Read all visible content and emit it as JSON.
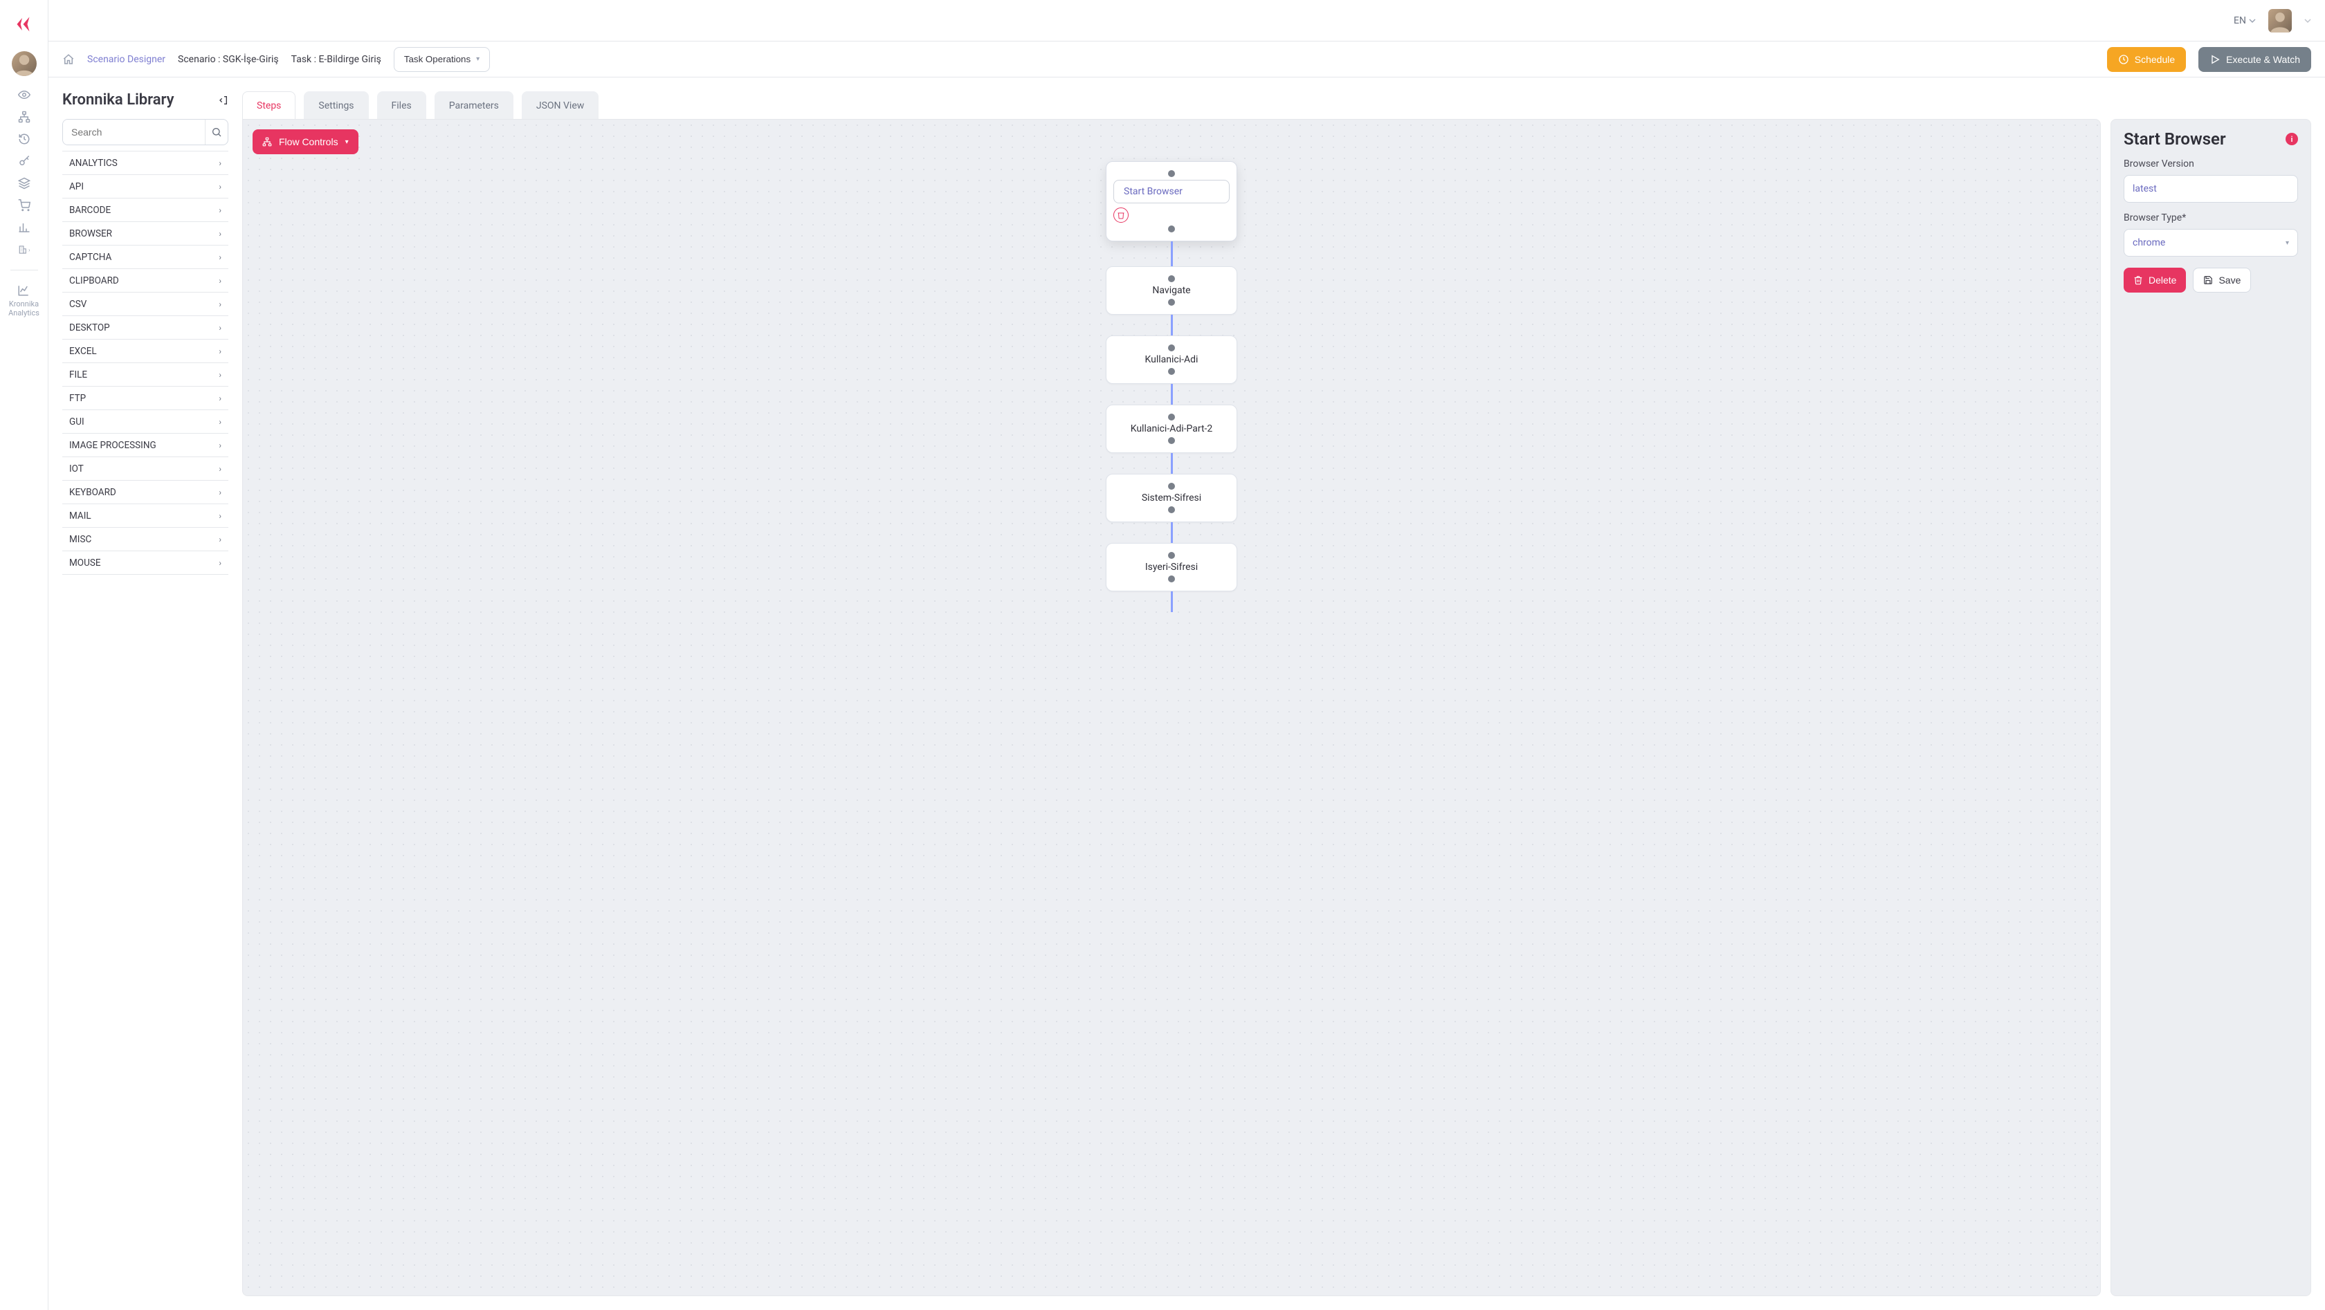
{
  "language": "EN",
  "breadcrumb": {
    "designer": "Scenario Designer",
    "scenario": "Scenario : SGK-İşe-Giriş",
    "task": "Task : E-Bildirge Giriş"
  },
  "taskOpsLabel": "Task Operations",
  "buttons": {
    "schedule": "Schedule",
    "execute": "Execute & Watch"
  },
  "library": {
    "title": "Kronnika Library",
    "searchPlaceholder": "Search",
    "categories": [
      "ANALYTICS",
      "API",
      "BARCODE",
      "BROWSER",
      "CAPTCHA",
      "CLIPBOARD",
      "CSV",
      "DESKTOP",
      "EXCEL",
      "FILE",
      "FTP",
      "GUI",
      "IMAGE PROCESSING",
      "IOT",
      "KEYBOARD",
      "MAIL",
      "MISC",
      "MOUSE"
    ]
  },
  "tabs": [
    "Steps",
    "Settings",
    "Files",
    "Parameters",
    "JSON View"
  ],
  "flowControlsLabel": "Flow Controls",
  "nodes": [
    "Start Browser",
    "Navigate",
    "Kullanici-Adi",
    "Kullanici-Adi-Part-2",
    "Sistem-Sifresi",
    "Isyeri-Sifresi"
  ],
  "props": {
    "title": "Start Browser",
    "fields": {
      "versionLabel": "Browser Version",
      "versionValue": "latest",
      "typeLabel": "Browser Type*",
      "typeValue": "chrome"
    },
    "delete": "Delete",
    "save": "Save"
  },
  "analytics": {
    "line1": "Kronnika",
    "line2": "Analytics"
  }
}
